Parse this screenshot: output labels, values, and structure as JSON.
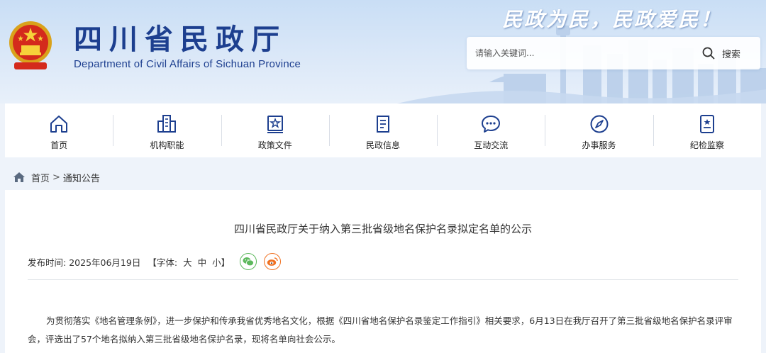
{
  "header": {
    "title": "四川省民政厅",
    "subtitle": "Department of Civil Affairs of Sichuan Province",
    "slogan": "民政为民，民政爱民！",
    "emblem_icon": "national-emblem-icon"
  },
  "search": {
    "placeholder": "请输入关键词...",
    "button_label": "搜索",
    "icon": "search-icon"
  },
  "nav": {
    "items": [
      {
        "label": "首页",
        "icon": "home-icon"
      },
      {
        "label": "机构职能",
        "icon": "building-icon"
      },
      {
        "label": "政策文件",
        "icon": "document-star-icon"
      },
      {
        "label": "民政信息",
        "icon": "news-icon"
      },
      {
        "label": "互动交流",
        "icon": "chat-icon"
      },
      {
        "label": "办事服务",
        "icon": "compass-icon"
      },
      {
        "label": "纪检监察",
        "icon": "badge-icon"
      }
    ]
  },
  "breadcrumb": {
    "items": [
      "首页",
      "通知公告"
    ],
    "separator": ">"
  },
  "article": {
    "title": "四川省民政厅关于纳入第三批省级地名保护名录拟定名单的公示",
    "publish_label": "发布时间:",
    "publish_date": "2025年06月19日",
    "font_size_label": "【字体:",
    "font_sizes": [
      "大",
      "中",
      "小】"
    ],
    "share_icons": [
      "wechat-icon",
      "weibo-icon"
    ],
    "body": "为贯彻落实《地名管理条例》，进一步保护和传承我省优秀地名文化，根据《四川省地名保护名录鉴定工作指引》相关要求，6月13日在我厅召开了第三批省级地名保护名录评审会，评选出了57个地名拟纳入第三批省级地名保护名录，现将名单向社会公示。"
  },
  "colors": {
    "brand_blue": "#1d3f8f",
    "background": "#eef3fa",
    "wechat_green": "#5cb85c",
    "weibo_orange": "#f07020"
  }
}
